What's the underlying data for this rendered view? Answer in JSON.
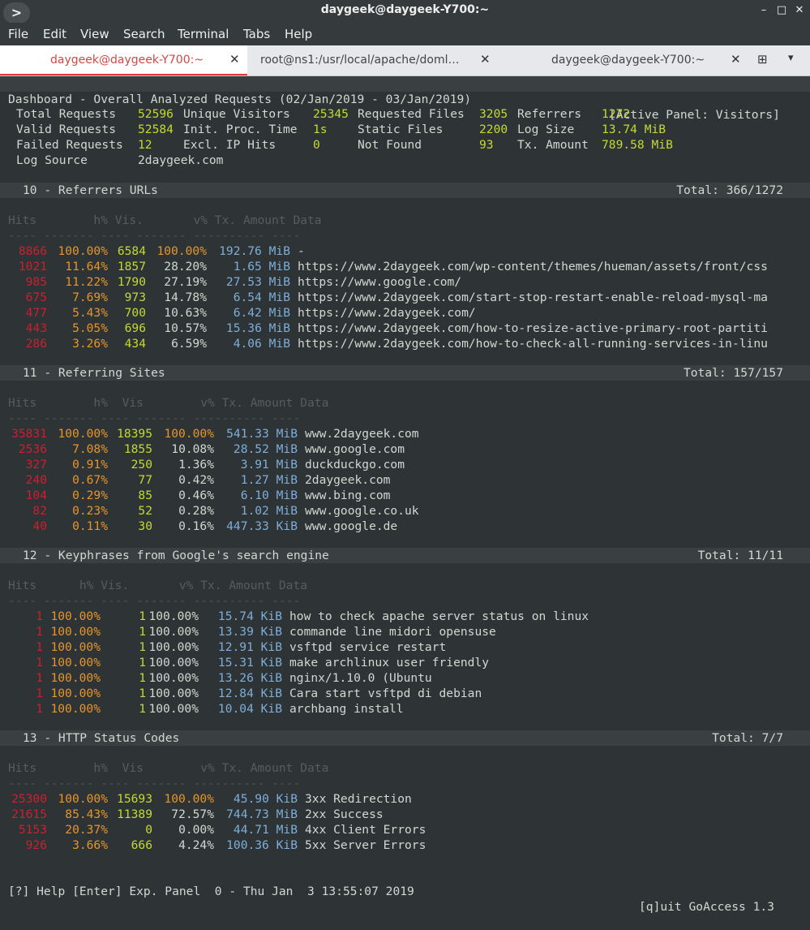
{
  "window": {
    "title": "daygeek@daygeek-Y700:~",
    "app_button": ">",
    "controls": [
      "–",
      "□",
      "✕"
    ]
  },
  "menu": [
    "File",
    "Edit",
    "View",
    "Search",
    "Terminal",
    "Tabs",
    "Help"
  ],
  "tabs": [
    {
      "label": "daygeek@daygeek-Y700:~",
      "active": true
    },
    {
      "label": "root@ns1:/usr/local/apache/doml…",
      "active": false
    },
    {
      "label": "daygeek@daygeek-Y700:~",
      "active": false
    }
  ],
  "dashboard": {
    "title": "Dashboard - Overall Analyzed Requests (02/Jan/2019 - 03/Jan/2019)",
    "active_panel": "[Active Panel: Visitors]",
    "stats": {
      "row1": [
        "Total Requests",
        "52596",
        "Unique Visitors",
        "25345",
        "Requested Files",
        "3205",
        "Referrers",
        "1272"
      ],
      "row2": [
        "Valid Requests",
        "52584",
        "Init. Proc. Time",
        "1s",
        "Static Files",
        "2200",
        "Log Size",
        "13.74 MiB"
      ],
      "row3": [
        "Failed Requests",
        "12",
        "Excl. IP Hits",
        "0",
        "Not Found",
        "93",
        "Tx. Amount",
        "789.58 MiB"
      ],
      "row4": [
        "Log Source",
        "2daygeek.com"
      ]
    }
  },
  "panels": [
    {
      "header": "10 - Referrers URLs",
      "total": "Total: 366/1272",
      "columns": "Hits        h% Vis.       v% Tx. Amount Data",
      "rows": [
        [
          "8866",
          "100.00%",
          "6584",
          "100.00%",
          "192.76 MiB",
          "-"
        ],
        [
          "1021",
          "11.64%",
          "1857",
          "28.20%",
          "1.65 MiB",
          "https://www.2daygeek.com/wp-content/themes/hueman/assets/front/css"
        ],
        [
          "985",
          "11.22%",
          "1790",
          "27.19%",
          "27.53 MiB",
          "https://www.google.com/"
        ],
        [
          "675",
          "7.69%",
          "973",
          "14.78%",
          "6.54 MiB",
          "https://www.2daygeek.com/start-stop-restart-enable-reload-mysql-ma"
        ],
        [
          "477",
          "5.43%",
          "700",
          "10.63%",
          "6.42 MiB",
          "https://www.2daygeek.com/"
        ],
        [
          "443",
          "5.05%",
          "696",
          "10.57%",
          "15.36 MiB",
          "https://www.2daygeek.com/how-to-resize-active-primary-root-partiti"
        ],
        [
          "286",
          "3.26%",
          "434",
          "6.59%",
          "4.06 MiB",
          "https://www.2daygeek.com/how-to-check-all-running-services-in-linu"
        ]
      ]
    },
    {
      "header": "11 - Referring Sites",
      "total": "Total: 157/157",
      "columns": "Hits        h%  Vis        v% Tx. Amount Data",
      "rows": [
        [
          "35831",
          "100.00%",
          "18395",
          "100.00%",
          "541.33 MiB",
          "www.2daygeek.com"
        ],
        [
          "2536",
          "7.08%",
          "1855",
          "10.08%",
          "28.52 MiB",
          "www.google.com"
        ],
        [
          "327",
          "0.91%",
          "250",
          "1.36%",
          "3.91 MiB",
          "duckduckgo.com"
        ],
        [
          "240",
          "0.67%",
          "77",
          "0.42%",
          "1.27 MiB",
          "2daygeek.com"
        ],
        [
          "104",
          "0.29%",
          "85",
          "0.46%",
          "6.10 MiB",
          "www.bing.com"
        ],
        [
          "82",
          "0.23%",
          "52",
          "0.28%",
          "1.02 MiB",
          "www.google.co.uk"
        ],
        [
          "40",
          "0.11%",
          "30",
          "0.16%",
          "447.33 KiB",
          "www.google.de"
        ]
      ]
    },
    {
      "header": "12 - Keyphrases from Google's search engine",
      "total": "Total: 11/11",
      "columns": "Hits      h% Vis.       v% Tx. Amount Data",
      "rows": [
        [
          "1",
          "100.00%",
          "1",
          "100.00%",
          "15.74 KiB",
          "how to check apache server status on linux"
        ],
        [
          "1",
          "100.00%",
          "1",
          "100.00%",
          "13.39 KiB",
          "commande line midori opensuse"
        ],
        [
          "1",
          "100.00%",
          "1",
          "100.00%",
          "12.91 KiB",
          "vsftpd service restart"
        ],
        [
          "1",
          "100.00%",
          "1",
          "100.00%",
          "15.31 KiB",
          "make archlinux user friendly"
        ],
        [
          "1",
          "100.00%",
          "1",
          "100.00%",
          "13.26 KiB",
          "nginx/1.10.0 (Ubuntu"
        ],
        [
          "1",
          "100.00%",
          "1",
          "100.00%",
          "12.84 KiB",
          "Cara start vsftpd di debian"
        ],
        [
          "1",
          "100.00%",
          "1",
          "100.00%",
          "10.04 KiB",
          "archbang install"
        ]
      ]
    },
    {
      "header": "13 - HTTP Status Codes",
      "total": "Total: 7/7",
      "columns": "Hits        h%  Vis        v% Tx. Amount Data",
      "rows": [
        [
          "25300",
          "100.00%",
          "15693",
          "100.00%",
          "45.90 KiB",
          "3xx Redirection"
        ],
        [
          "21615",
          "85.43%",
          "11389",
          "72.57%",
          "744.73 MiB",
          "2xx Success"
        ],
        [
          "5153",
          "20.37%",
          "0",
          "0.00%",
          "44.71 MiB",
          "4xx Client Errors"
        ],
        [
          "926",
          "3.66%",
          "666",
          "4.24%",
          "100.36 KiB",
          "5xx Server Errors"
        ]
      ]
    }
  ],
  "footer": {
    "left": "[?] Help [Enter] Exp. Panel  0 - Thu Jan  3 13:55:07 2019",
    "right": "[q]uit GoAccess 1.3"
  },
  "colors": {
    "terminal_bg": "#2e3436",
    "hits": "#cc1f2f",
    "percent": "#e6952a",
    "visitors": "#c4d932",
    "amount": "#7eaed9",
    "active_tab": "#d64545"
  }
}
